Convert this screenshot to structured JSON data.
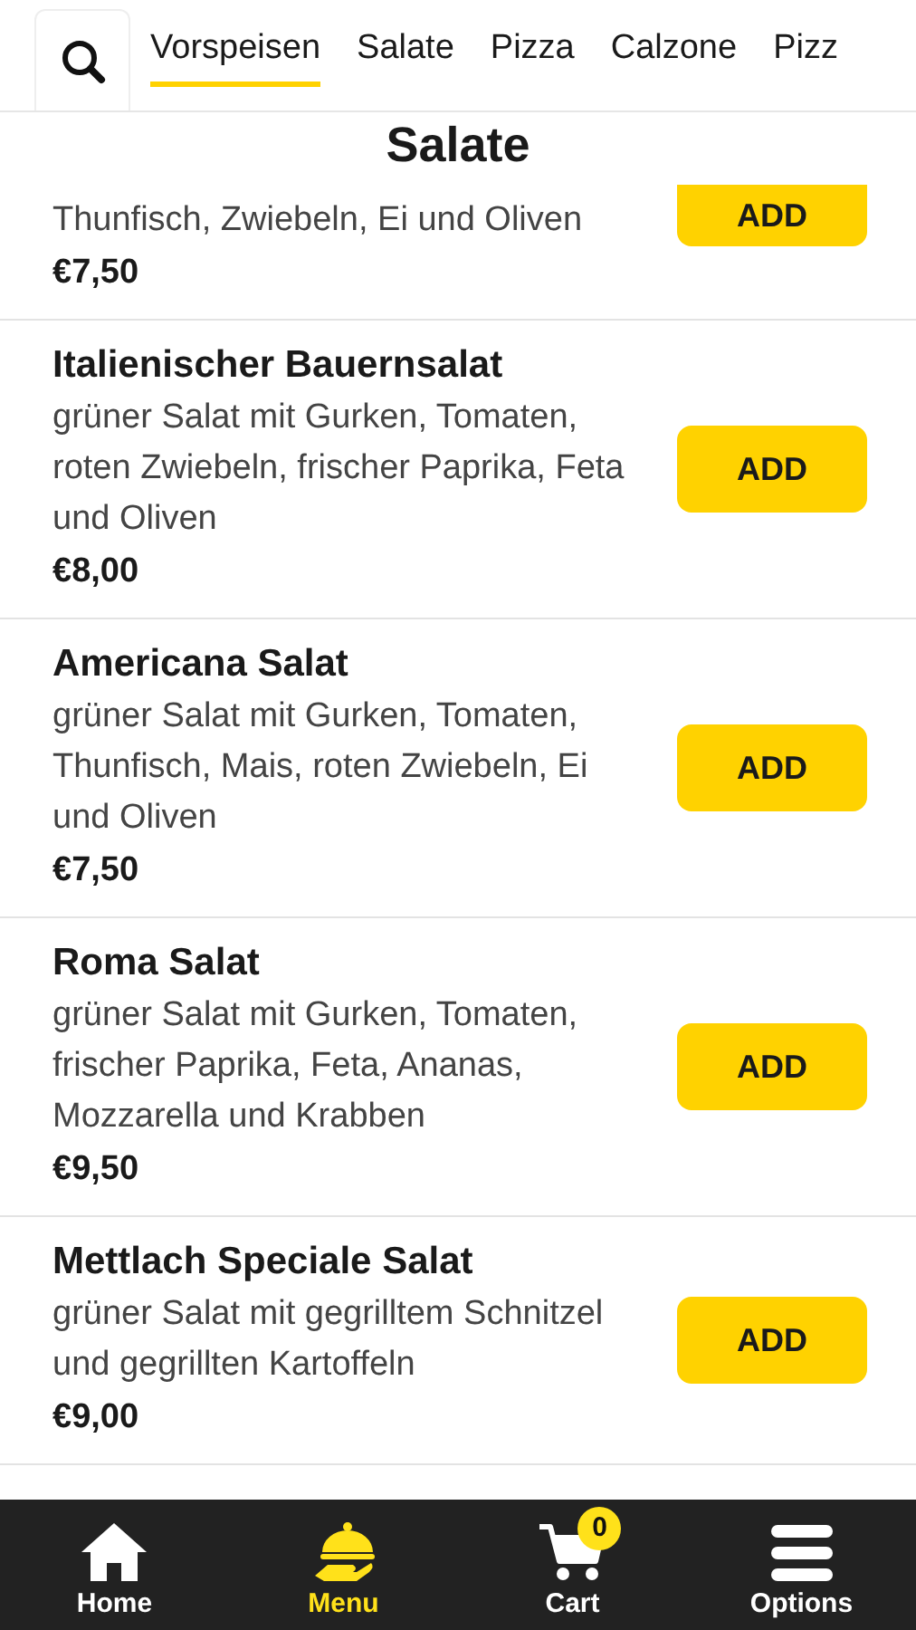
{
  "tabs": [
    {
      "label": "Vorspeisen",
      "selected": true
    },
    {
      "label": "Salate",
      "selected": false
    },
    {
      "label": "Pizza",
      "selected": false
    },
    {
      "label": "Calzone",
      "selected": false
    },
    {
      "label": "Pizz",
      "selected": false
    }
  ],
  "section_title": "Salate",
  "items": [
    {
      "kind": "partial",
      "description": "Thunfisch, Zwiebeln, Ei und Oliven",
      "price": "€7,50",
      "button": "ADD"
    },
    {
      "kind": "full",
      "name": "Italienischer Bauernsalat",
      "description": "grüner Salat mit Gurken, Tomaten, roten Zwiebeln, frischer Paprika, Feta und Oliven",
      "price": "€8,00",
      "button": "ADD"
    },
    {
      "kind": "full",
      "name": "Americana Salat",
      "description": "grüner Salat mit Gurken, Tomaten, Thunfisch, Mais, roten Zwiebeln, Ei und Oliven",
      "price": "€7,50",
      "button": "ADD"
    },
    {
      "kind": "full",
      "name": "Roma Salat",
      "description": "grüner Salat mit Gurken, Tomaten, frischer Paprika, Feta, Ananas, Mozzarella und Krabben",
      "price": "€9,50",
      "button": "ADD"
    },
    {
      "kind": "full",
      "name": "Mettlach Speciale Salat",
      "description": "grüner Salat mit gegrilltem Schnitzel und gegrillten Kartoffeln",
      "price": "€9,00",
      "button": "ADD"
    }
  ],
  "nav": [
    {
      "kind": "home",
      "label": "Home",
      "selected": false
    },
    {
      "kind": "menu",
      "label": "Menu",
      "selected": true
    },
    {
      "kind": "cart",
      "label": "Cart",
      "selected": false,
      "badge": "0"
    },
    {
      "kind": "options",
      "label": "Options",
      "selected": false
    }
  ]
}
